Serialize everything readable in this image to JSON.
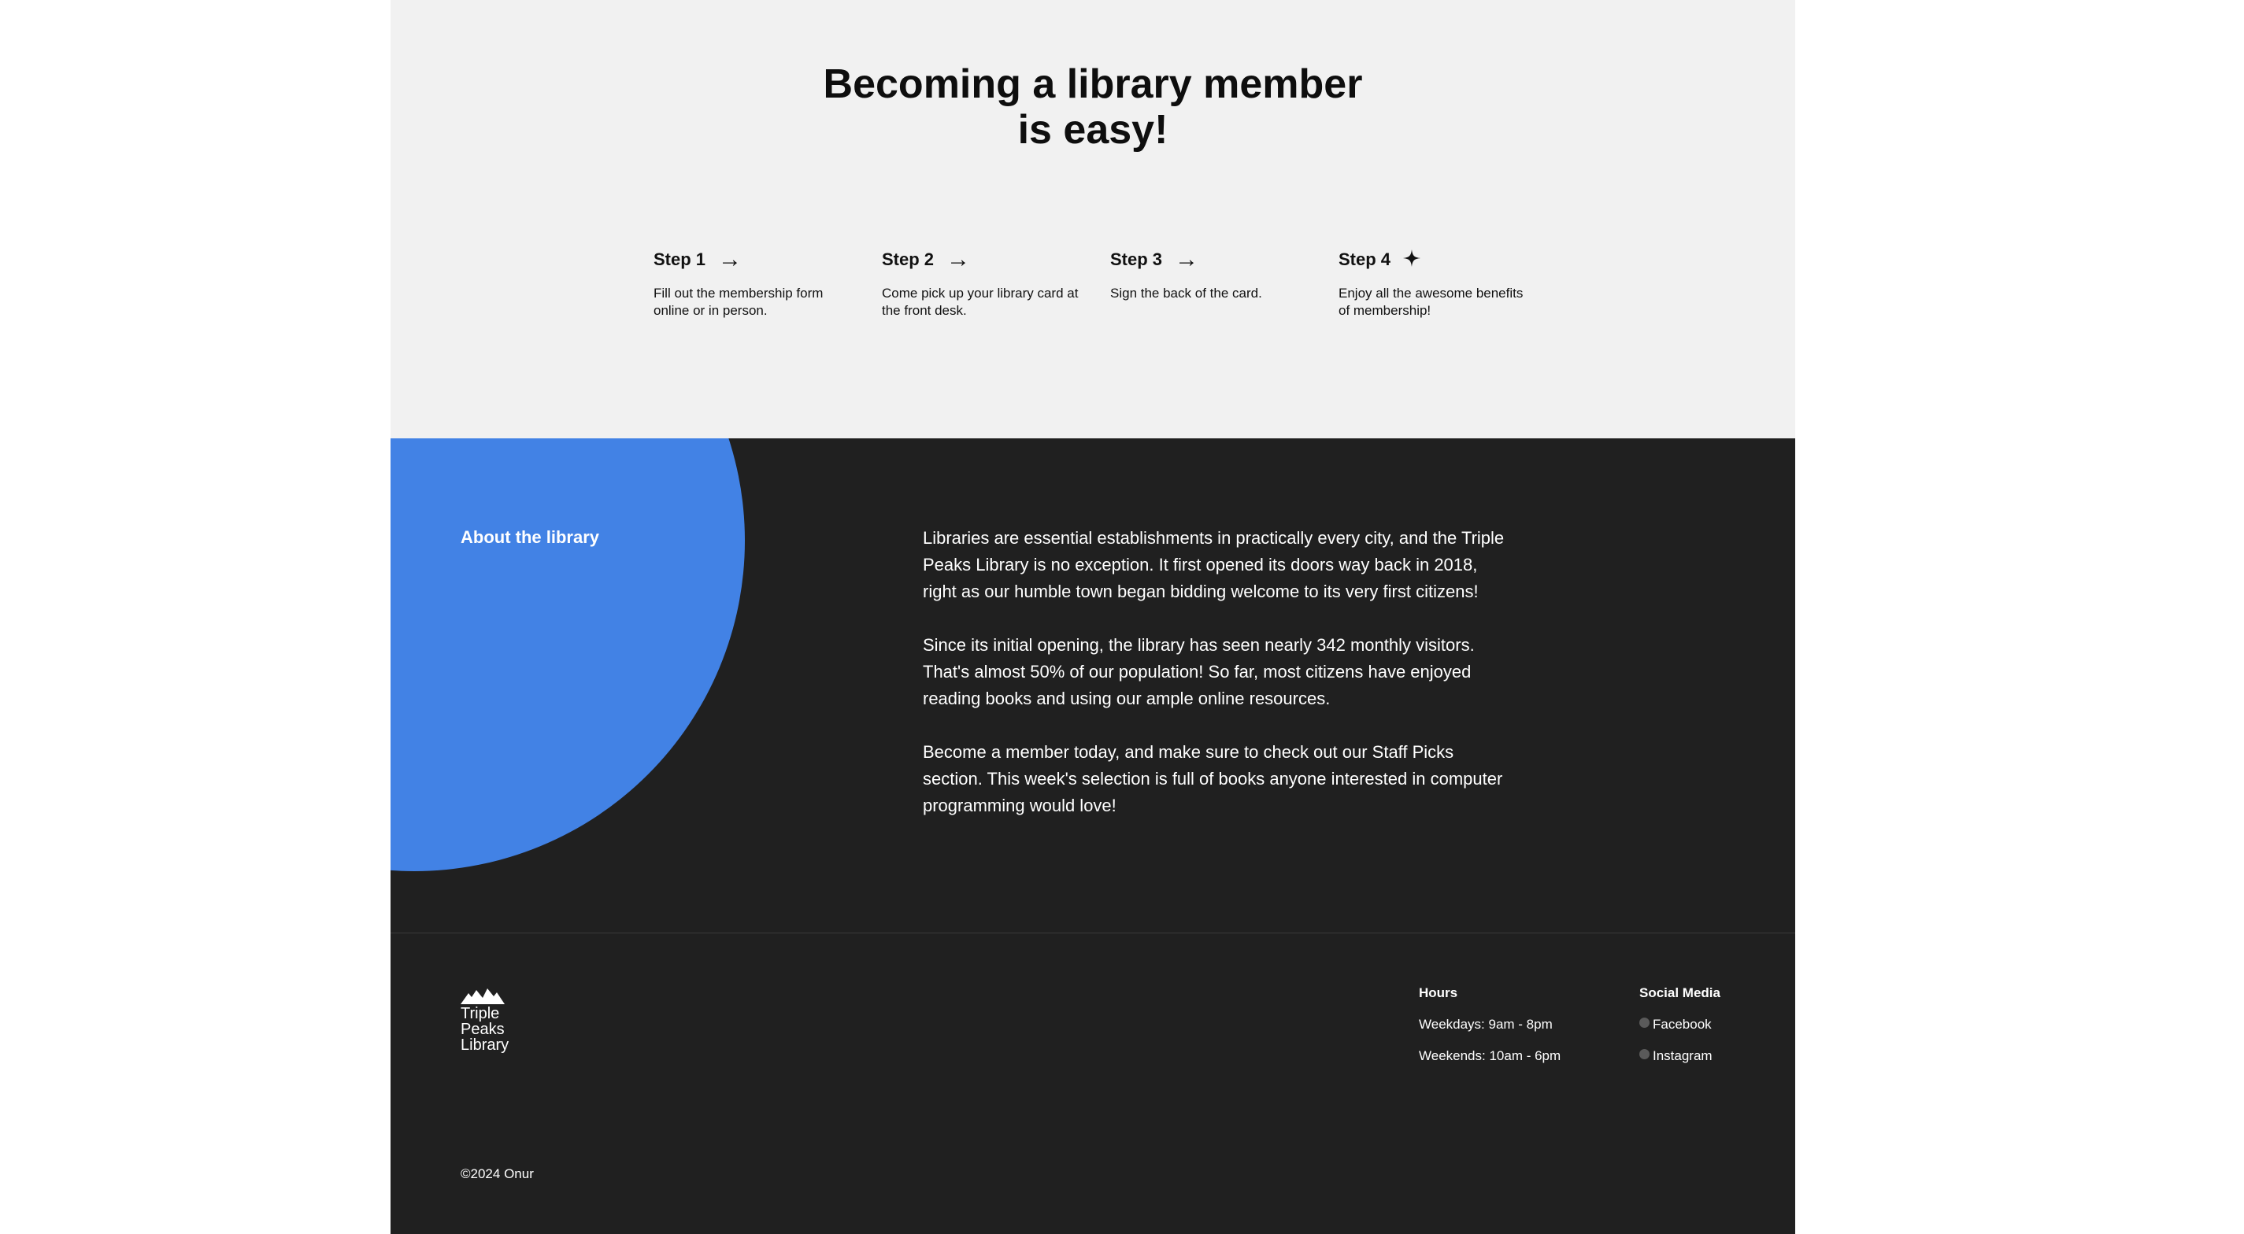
{
  "membership": {
    "heading_line1": "Becoming a library member",
    "heading_line2": "is easy!",
    "steps": [
      {
        "title": "Step 1",
        "icon": "arrow-right",
        "text": "Fill out the membership form online or in person."
      },
      {
        "title": "Step 2",
        "icon": "arrow-right",
        "text": "Come pick up your library card at the front desk."
      },
      {
        "title": "Step 3",
        "icon": "arrow-right",
        "text": "Sign the back of the card."
      },
      {
        "title": "Step 4",
        "icon": "sparkle",
        "text": "Enjoy all the awesome benefits of membership!"
      }
    ]
  },
  "about": {
    "title": "About the library",
    "paragraphs": [
      "Libraries are essential establishments in practically every city, and the Triple Peaks Library is no exception. It first opened its doors way back in 2018, right as our humble town began bidding welcome to its very first citizens!",
      "Since its initial opening, the library has seen nearly 342 monthly visitors. That's almost 50% of our population! So far, most citizens have enjoyed reading books and using our ample online resources.",
      "Become a member today, and make sure to check out our Staff Picks section. This week's selection is full of books anyone interested in computer programming would love!"
    ]
  },
  "footer": {
    "logo_line1": "Triple",
    "logo_line2": "Peaks",
    "logo_line3": "Library",
    "hours_title": "Hours",
    "hours": [
      "Weekdays: 9am - 8pm",
      "Weekends: 10am - 6pm"
    ],
    "social_title": "Social Media",
    "social": [
      "Facebook",
      "Instagram"
    ],
    "copyright": "©2024 Onur"
  },
  "colors": {
    "accent_blue": "#4282e5",
    "dark_bg": "#202020",
    "light_bg": "#f1f1f1"
  }
}
